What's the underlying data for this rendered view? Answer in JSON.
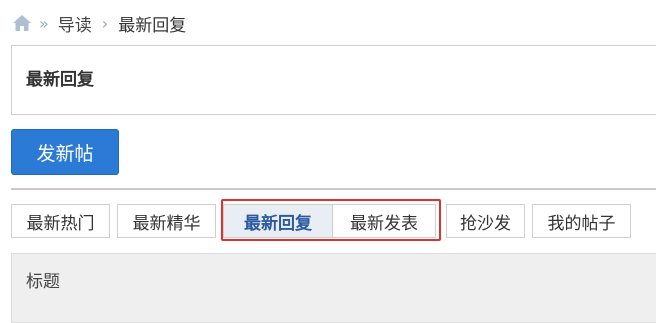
{
  "breadcrumb": {
    "home_icon": "home-icon",
    "separator_1": "»",
    "link": "导读",
    "separator_2": "›",
    "current": "最新回复"
  },
  "page_title": "最新回复",
  "post_button_label": "发新帖",
  "tabs": [
    {
      "label": "最新热门",
      "active": false
    },
    {
      "label": "最新精华",
      "active": false
    },
    {
      "label": "最新回复",
      "active": true
    },
    {
      "label": "最新发表",
      "active": false
    },
    {
      "label": "抢沙发",
      "active": false
    },
    {
      "label": "我的帖子",
      "active": false
    }
  ],
  "table_header": {
    "title_label": "标题"
  },
  "colors": {
    "accent": "#2a7ad6",
    "highlight_box": "#e0312f",
    "active_tab_bg": "#e9eef5"
  }
}
